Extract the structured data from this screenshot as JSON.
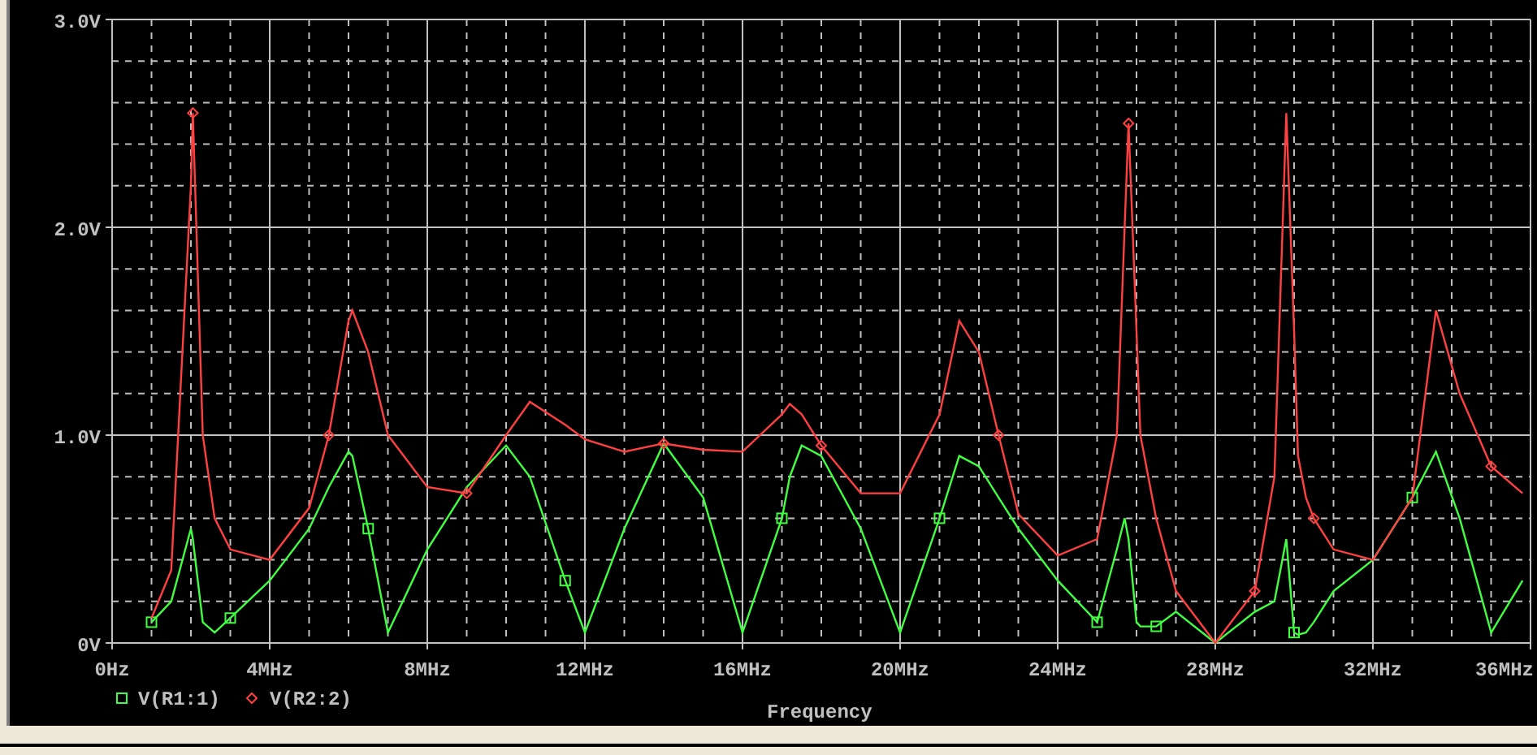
{
  "chart_data": {
    "type": "line",
    "xlabel": "Frequency",
    "grid": true,
    "legend": true,
    "x": [
      1,
      1.5,
      2,
      2.05,
      2.3,
      2.6,
      3,
      4,
      5,
      5.5,
      6,
      6.1,
      6.5,
      7,
      8,
      9,
      10,
      10.6,
      11.5,
      12,
      13,
      14,
      15,
      16,
      17,
      17.2,
      17.5,
      18,
      19,
      20,
      21,
      21.5,
      22,
      22.5,
      23,
      24,
      25,
      25.5,
      25.7,
      25.8,
      26,
      26.1,
      26.5,
      27,
      28,
      29,
      29.5,
      29.8,
      30,
      30.1,
      30.3,
      30.5,
      31,
      32,
      33,
      33.6,
      34.2,
      35,
      35.8
    ],
    "series": [
      {
        "name": "V(R1:1)",
        "color": "#40ff40",
        "values": [
          0.1,
          0.2,
          0.55,
          0.5,
          0.1,
          0.05,
          0.12,
          0.3,
          0.55,
          0.75,
          0.92,
          0.9,
          0.55,
          0.05,
          0.45,
          0.75,
          0.95,
          0.8,
          0.3,
          0.05,
          0.55,
          0.96,
          0.7,
          0.05,
          0.6,
          0.8,
          0.95,
          0.9,
          0.55,
          0.05,
          0.6,
          0.9,
          0.85,
          0.7,
          0.55,
          0.3,
          0.1,
          0.45,
          0.6,
          0.5,
          0.1,
          0.08,
          0.08,
          0.15,
          0.0,
          0.15,
          0.2,
          0.5,
          0.05,
          0.04,
          0.05,
          0.1,
          0.25,
          0.4,
          0.7,
          0.92,
          0.6,
          0.05,
          0.3
        ]
      },
      {
        "name": "V(R2:2)",
        "color": "#ff4040",
        "values": [
          0.12,
          0.35,
          2.2,
          2.55,
          1.0,
          0.6,
          0.45,
          0.4,
          0.65,
          1.0,
          1.55,
          1.6,
          1.4,
          1.0,
          0.75,
          0.72,
          1.0,
          1.16,
          1.05,
          0.98,
          0.92,
          0.96,
          0.93,
          0.92,
          1.1,
          1.15,
          1.1,
          0.95,
          0.72,
          0.72,
          1.1,
          1.55,
          1.4,
          1.0,
          0.62,
          0.42,
          0.5,
          1.0,
          2.0,
          2.5,
          1.5,
          1.0,
          0.6,
          0.25,
          0.0,
          0.25,
          0.8,
          2.55,
          1.5,
          0.9,
          0.7,
          0.6,
          0.45,
          0.4,
          0.7,
          1.6,
          1.2,
          0.85,
          0.72
        ]
      }
    ],
    "xlim": [
      0,
      36
    ],
    "ylim": [
      0,
      3
    ],
    "xticks": [
      {
        "value": 0,
        "label": "0Hz"
      },
      {
        "value": 4,
        "label": "4MHz"
      },
      {
        "value": 8,
        "label": "8MHz"
      },
      {
        "value": 12,
        "label": "12MHz"
      },
      {
        "value": 16,
        "label": "16MHz"
      },
      {
        "value": 20,
        "label": "20MHz"
      },
      {
        "value": 24,
        "label": "24MHz"
      },
      {
        "value": 28,
        "label": "28MHz"
      },
      {
        "value": 32,
        "label": "32MHz"
      },
      {
        "value": 36,
        "label": "36MHz"
      }
    ],
    "yticks": [
      {
        "value": 0,
        "label": "0V"
      },
      {
        "value": 1,
        "label": "1.0V"
      },
      {
        "value": 2,
        "label": "2.0V"
      },
      {
        "value": 3,
        "label": "3.0V"
      }
    ]
  }
}
